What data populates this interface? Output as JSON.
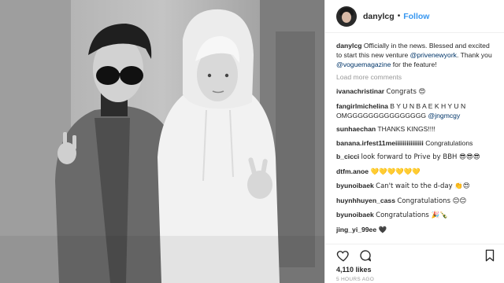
{
  "post": {
    "username": "danylcg",
    "dot": "•",
    "follow_label": "Follow",
    "caption": {
      "user": "danylcg",
      "text_1": "Officially in the news. Blessed and excited to start this new venture",
      "mention_1": "@privenewyork",
      "text_2": ". Thank you",
      "mention_2": "@voguemagazine",
      "text_3": "for the feature!"
    },
    "load_more": "Load more comments",
    "comments": [
      {
        "user": "ivanachristinar",
        "text": "Congrats 😍"
      },
      {
        "user": "fangirlmichelina",
        "text": "B Y U N B A E K H Y U N OMGGGGGGGGGGGGGGG",
        "mention": "@jngmcgy"
      },
      {
        "user": "sunhaechan",
        "text": "THANKS KINGS!!!!"
      },
      {
        "user": "banana.irfest11meiiiiiiiiiiiiiii",
        "text": "Congratulations"
      },
      {
        "user": "b_cicci",
        "text": "look forward to Prive by BBH 😎😎😎"
      },
      {
        "user": "dtfm.anoe",
        "text": "💛💛💛💛💛💛"
      },
      {
        "user": "byunoibaek",
        "text": "Can't wait to the d-day 👏😍"
      },
      {
        "user": "huynhhuyen_cass",
        "text": "Congratulations 😊😊"
      },
      {
        "user": "byunoibaek",
        "text": "Congratulations 🎉🍾"
      },
      {
        "user": "jing_yi_99ee",
        "text": "🖤"
      }
    ],
    "likes": "4,110 likes",
    "time": "5 HOURS AGO"
  },
  "icons": {
    "like": "heart-icon",
    "comment": "comment-icon",
    "save": "bookmark-icon"
  }
}
